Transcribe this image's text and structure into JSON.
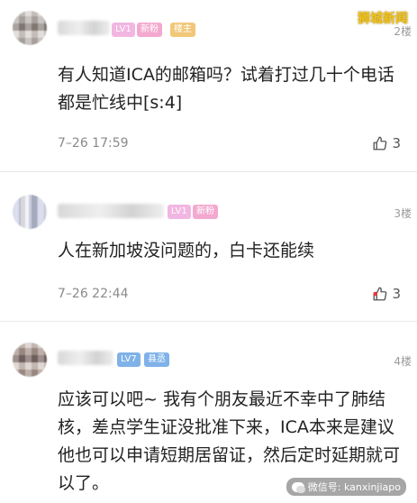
{
  "watermark": {
    "brand": "狮城新闻",
    "wechat": "微信号: kanxinjiapo"
  },
  "posts": [
    {
      "badges": [
        "LV1",
        "新粉",
        "楼主"
      ],
      "floor": "2楼",
      "content": "有人知道ICA的邮箱吗？试着打过几十个电话都是忙线中[s:4]",
      "time": "7–26 17:59",
      "likes": "3"
    },
    {
      "badges": [
        "LV1",
        "新粉"
      ],
      "floor": "3楼",
      "content": "人在新加坡没问题的，白卡还能续",
      "time": "7–26 22:44",
      "likes": "3"
    },
    {
      "badges": [
        "LV7",
        "县丞"
      ],
      "floor": "4楼",
      "content": "应该可以吧~ 我有个朋友最近不幸中了肺结核，差点学生证没批准下来，ICA本来是建议他也可以申请短期居留证，然后定时延期就可以了。",
      "time": "",
      "likes": ""
    }
  ],
  "colors": {
    "accent": "#f2c31a",
    "like_active": "#e33",
    "text": "#222222"
  },
  "icons": {
    "like": "thumbs-up-icon",
    "wechat": "wechat-icon"
  }
}
